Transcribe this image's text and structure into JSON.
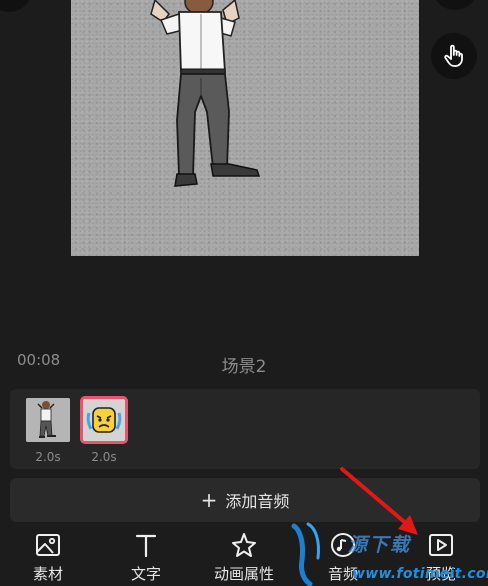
{
  "preview": {
    "time": "00:08",
    "scene": "场景2"
  },
  "timeline": {
    "clips": [
      {
        "duration": "2.0s",
        "selected": false,
        "icon": "person-thumbnail"
      },
      {
        "duration": "2.0s",
        "selected": true,
        "icon": "emoji-sticker-thumbnail"
      }
    ]
  },
  "add_audio": {
    "label": "添加音频"
  },
  "toolbar": {
    "items": [
      {
        "label": "素材",
        "icon": "image-icon"
      },
      {
        "label": "文字",
        "icon": "text-icon"
      },
      {
        "label": "动画属性",
        "icon": "animation-star-icon"
      },
      {
        "label": "音频",
        "icon": "music-icon"
      },
      {
        "label": "预览",
        "icon": "play-preview-icon"
      }
    ]
  },
  "watermark": {
    "domain": "www.fotimeit.com",
    "cn": "源下载"
  },
  "colors": {
    "background": "#1c1c1c",
    "accent_selected": "#e8546c",
    "annotation_arrow": "#e01818"
  }
}
